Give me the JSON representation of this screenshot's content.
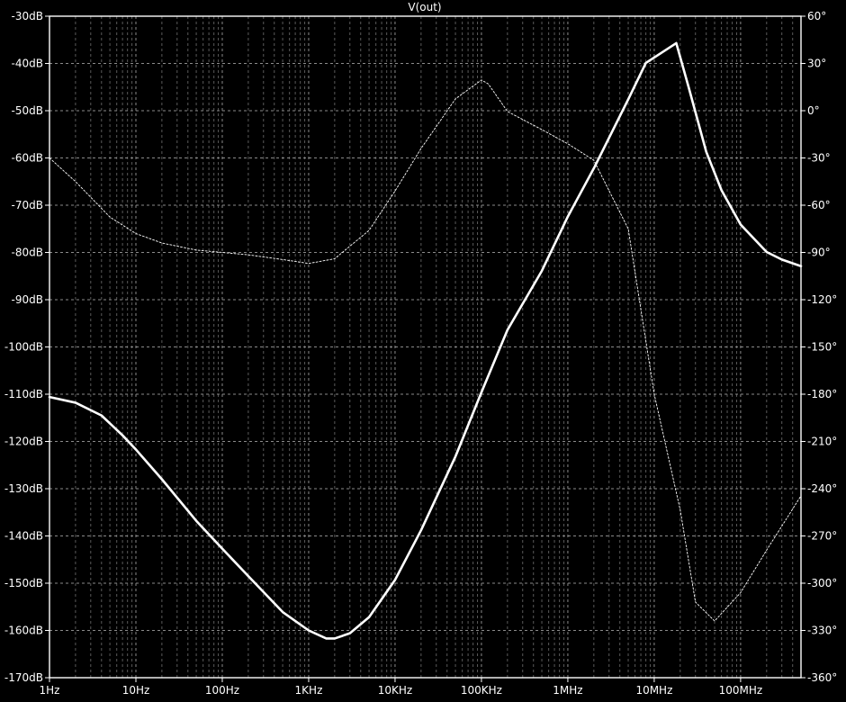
{
  "chart_data": {
    "type": "line",
    "title": "V(out)",
    "x_scale": "log",
    "x_range_hz": [
      1,
      500000000
    ],
    "x_ticks": [
      {
        "value": 1,
        "label": "1Hz"
      },
      {
        "value": 10,
        "label": "10Hz"
      },
      {
        "value": 100,
        "label": "100Hz"
      },
      {
        "value": 1000,
        "label": "1KHz"
      },
      {
        "value": 10000,
        "label": "10KHz"
      },
      {
        "value": 100000,
        "label": "100KHz"
      },
      {
        "value": 1000000,
        "label": "1MHz"
      },
      {
        "value": 10000000,
        "label": "10MHz"
      },
      {
        "value": 100000000,
        "label": "100MHz"
      }
    ],
    "y_left": {
      "range": [
        -170,
        -30
      ],
      "ticks": [
        {
          "value": -30,
          "label": "-30dB"
        },
        {
          "value": -40,
          "label": "-40dB"
        },
        {
          "value": -50,
          "label": "-50dB"
        },
        {
          "value": -60,
          "label": "-60dB"
        },
        {
          "value": -70,
          "label": "-70dB"
        },
        {
          "value": -80,
          "label": "-80dB"
        },
        {
          "value": -90,
          "label": "-90dB"
        },
        {
          "value": -100,
          "label": "-100dB"
        },
        {
          "value": -110,
          "label": "-110dB"
        },
        {
          "value": -120,
          "label": "-120dB"
        },
        {
          "value": -130,
          "label": "-130dB"
        },
        {
          "value": -140,
          "label": "-140dB"
        },
        {
          "value": -150,
          "label": "-150dB"
        },
        {
          "value": -160,
          "label": "-160dB"
        },
        {
          "value": -170,
          "label": "-170dB"
        }
      ]
    },
    "y_right": {
      "range": [
        -360,
        60
      ],
      "ticks": [
        {
          "value": 60,
          "label": "60°"
        },
        {
          "value": 30,
          "label": "30°"
        },
        {
          "value": 0,
          "label": "0°"
        },
        {
          "value": -30,
          "label": "-30°"
        },
        {
          "value": -60,
          "label": "-60°"
        },
        {
          "value": -90,
          "label": "-90°"
        },
        {
          "value": -120,
          "label": "-120°"
        },
        {
          "value": -150,
          "label": "-150°"
        },
        {
          "value": -180,
          "label": "-180°"
        },
        {
          "value": -210,
          "label": "-210°"
        },
        {
          "value": -240,
          "label": "-240°"
        },
        {
          "value": -270,
          "label": "-270°"
        },
        {
          "value": -300,
          "label": "-300°"
        },
        {
          "value": -330,
          "label": "-330°"
        },
        {
          "value": -360,
          "label": "-360°"
        }
      ]
    },
    "grid": true,
    "series": [
      {
        "style": "solid",
        "axis": "left",
        "color": "#ffffff",
        "points": [
          [
            1,
            -110.6
          ],
          [
            2,
            -111.8
          ],
          [
            4,
            -114.5
          ],
          [
            7,
            -118.7
          ],
          [
            10,
            -121.7
          ],
          [
            20,
            -128.0
          ],
          [
            50,
            -136.8
          ],
          [
            100,
            -142.7
          ],
          [
            200,
            -148.5
          ],
          [
            500,
            -156.1
          ],
          [
            1000,
            -160.0
          ],
          [
            1600,
            -161.7
          ],
          [
            2000,
            -161.7
          ],
          [
            3000,
            -160.6
          ],
          [
            5000,
            -157.2
          ],
          [
            10000,
            -149.3
          ],
          [
            20000,
            -138.8
          ],
          [
            50000,
            -123.2
          ],
          [
            100000,
            -109.6
          ],
          [
            200000,
            -96.4
          ],
          [
            500000,
            -83.9
          ],
          [
            1000000,
            -72.4
          ],
          [
            2000000,
            -62.2
          ],
          [
            5000000,
            -47.6
          ],
          [
            8000000,
            -39.9
          ],
          [
            12000000,
            -37.8
          ],
          [
            18000000,
            -35.7
          ],
          [
            25000000,
            -45.0
          ],
          [
            40000000,
            -58.7
          ],
          [
            60000000,
            -66.8
          ],
          [
            100000000,
            -74.1
          ],
          [
            200000000,
            -79.9
          ],
          [
            300000000,
            -81.5
          ],
          [
            500000000,
            -82.9
          ]
        ]
      },
      {
        "style": "dashed",
        "axis": "right",
        "color": "#ffffff",
        "points": [
          [
            1,
            -30
          ],
          [
            2,
            -45
          ],
          [
            5,
            -67.5
          ],
          [
            10,
            -78
          ],
          [
            20,
            -84
          ],
          [
            50,
            -88.5
          ],
          [
            100,
            -90
          ],
          [
            200,
            -91.5
          ],
          [
            500,
            -94.5
          ],
          [
            1000,
            -97
          ],
          [
            2000,
            -94
          ],
          [
            5000,
            -76
          ],
          [
            10000,
            -51
          ],
          [
            20000,
            -24
          ],
          [
            50000,
            7.5
          ],
          [
            100000,
            19.5
          ],
          [
            120000,
            17
          ],
          [
            200000,
            -0.5
          ],
          [
            500000,
            -12
          ],
          [
            1000000,
            -21
          ],
          [
            2000000,
            -31.5
          ],
          [
            5000000,
            -75
          ],
          [
            10000000,
            -180
          ],
          [
            20000000,
            -253.5
          ],
          [
            30000000,
            -312
          ],
          [
            50000000,
            -324
          ],
          [
            100000000,
            -306
          ],
          [
            200000000,
            -279
          ],
          [
            500000000,
            -244.5
          ]
        ]
      }
    ]
  }
}
